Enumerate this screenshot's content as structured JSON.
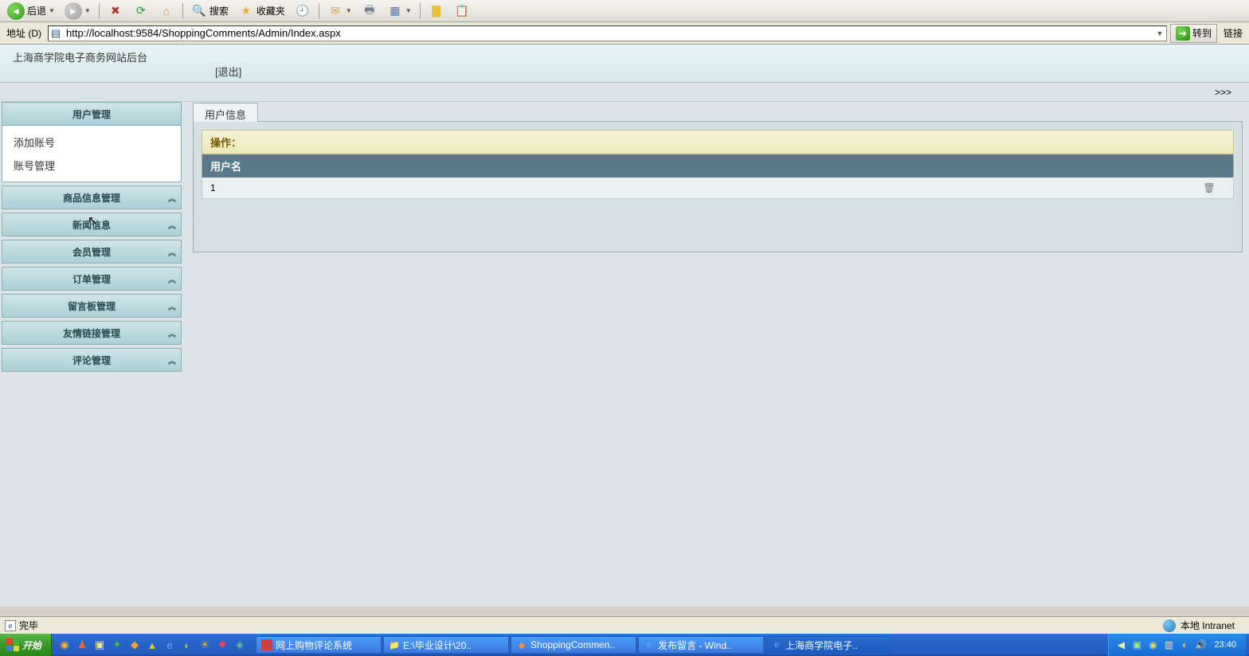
{
  "toolbar": {
    "back": "后退",
    "search": "搜索",
    "favorites": "收藏夹"
  },
  "addressBar": {
    "label": "地址 (D)",
    "url": "http://localhost:9584/ShoppingComments/Admin/Index.aspx",
    "go": "转到",
    "links": "链接"
  },
  "header": {
    "title": "上海商学院电子商务网站后台",
    "logout": "[退出]"
  },
  "breadcrumb": ">>>",
  "sidebar": {
    "sections": [
      {
        "title": "用户管理",
        "expanded": true,
        "items": [
          "添加账号",
          "账号管理"
        ]
      },
      {
        "title": "商品信息管理",
        "expanded": false
      },
      {
        "title": "新闻信息",
        "expanded": false
      },
      {
        "title": "会员管理",
        "expanded": false
      },
      {
        "title": "订单管理",
        "expanded": false
      },
      {
        "title": "留言板管理",
        "expanded": false
      },
      {
        "title": "友情链接管理",
        "expanded": false
      },
      {
        "title": "评论管理",
        "expanded": false
      }
    ]
  },
  "content": {
    "tab": "用户信息",
    "opLabel": "操作：",
    "columnHeader": "用户名",
    "rows": [
      {
        "username": "1",
        "deleteIcon": "🗑"
      }
    ]
  },
  "statusBar": {
    "done": "完毕",
    "zone": "本地 Intranet"
  },
  "taskbar": {
    "start": "开始",
    "tasks": [
      "网上购物评论系统",
      "E:\\毕业设计\\20..",
      "ShoppingCommen..",
      "发布留言 - Wind..",
      "上海商学院电子.."
    ],
    "clock": "23:40"
  }
}
